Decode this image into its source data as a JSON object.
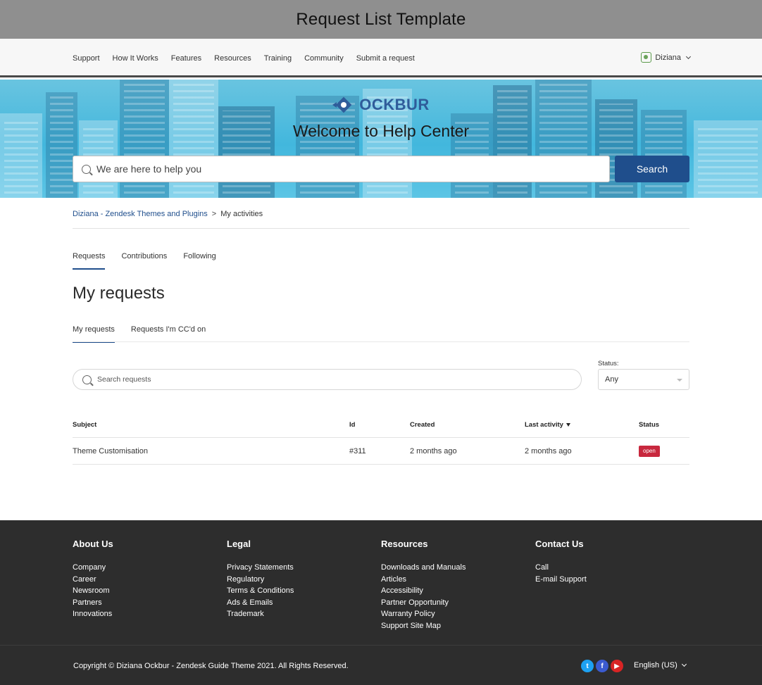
{
  "template_title": "Request List Template",
  "nav": {
    "links": [
      "Support",
      "How It Works",
      "Features",
      "Resources",
      "Training",
      "Community",
      "Submit a request"
    ],
    "user_name": "Diziana"
  },
  "hero": {
    "logo_text": "OCKBUR",
    "welcome": "Welcome to Help Center",
    "search_placeholder": "We are here to help you",
    "search_button": "Search"
  },
  "breadcrumb": {
    "parent": "Diziana - Zendesk Themes and Plugins",
    "separator": ">",
    "current": "My activities"
  },
  "tabs": [
    "Requests",
    "Contributions",
    "Following"
  ],
  "page_title": "My requests",
  "subtabs": [
    "My requests",
    "Requests I'm CC'd on"
  ],
  "filter": {
    "search_placeholder": "Search requests",
    "status_label": "Status:",
    "status_value": "Any"
  },
  "table": {
    "headers": [
      "Subject",
      "Id",
      "Created",
      "Last activity",
      "Status"
    ],
    "rows": [
      {
        "subject": "Theme Customisation",
        "id": "#311",
        "created": "2 months ago",
        "last_activity": "2 months ago",
        "status": "open"
      }
    ]
  },
  "footer": {
    "columns": [
      {
        "title": "About Us",
        "items": [
          "Company",
          "Career",
          "Newsroom",
          "Partners",
          "Innovations"
        ]
      },
      {
        "title": "Legal",
        "items": [
          "Privacy Statements",
          "Regulatory",
          "Terms & Conditions",
          "Ads & Emails",
          "Trademark"
        ]
      },
      {
        "title": "Resources",
        "items": [
          "Downloads and Manuals",
          "Articles",
          "Accessibility",
          "Partner Opportunity",
          "Warranty Policy",
          "Support Site Map"
        ]
      },
      {
        "title": "Contact Us",
        "items": [
          "Call",
          "E-mail Support"
        ]
      }
    ],
    "copyright": "Copyright © Diziana Ockbur - Zendesk Guide Theme 2021. All Rights Reserved.",
    "social_icons": [
      "twitter-icon",
      "facebook-icon",
      "youtube-icon"
    ],
    "language": "English (US)"
  },
  "colors": {
    "primary": "#1f4e8c",
    "status_open": "#c8283e",
    "footer_bg": "#2d2d2d",
    "hero": "#42b7dd"
  }
}
